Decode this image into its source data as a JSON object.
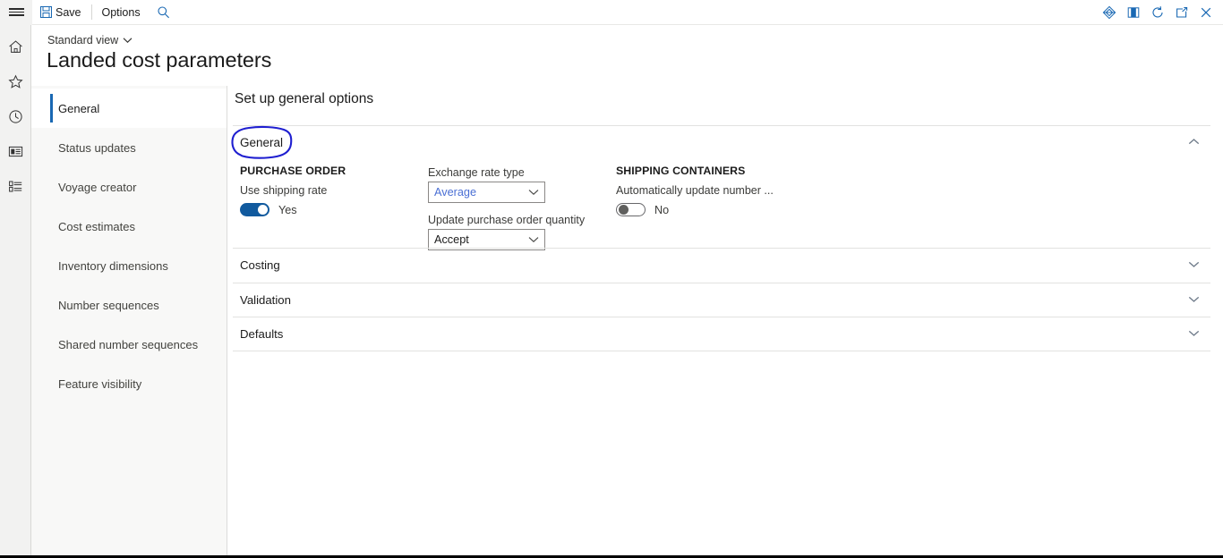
{
  "topbar": {
    "menu_icon": "hamburger-icon",
    "save_label": "Save",
    "save_icon": "save-disk-icon",
    "options_label": "Options",
    "search_icon": "search-icon",
    "right_icons": [
      {
        "name": "company-diamond-icon",
        "glyph": "diamond"
      },
      {
        "name": "contrast-icon",
        "glyph": "contrast"
      },
      {
        "name": "refresh-icon",
        "glyph": "refresh"
      },
      {
        "name": "open-in-new-window-icon",
        "glyph": "popout"
      },
      {
        "name": "close-icon",
        "glyph": "close"
      }
    ]
  },
  "rail": {
    "items": [
      {
        "name": "home-icon",
        "glyph": "home"
      },
      {
        "name": "favorites-star-icon",
        "glyph": "star"
      },
      {
        "name": "recent-clock-icon",
        "glyph": "clock"
      },
      {
        "name": "workspaces-icon",
        "glyph": "workspace"
      },
      {
        "name": "modules-list-icon",
        "glyph": "list"
      }
    ]
  },
  "header": {
    "view_label": "Standard view",
    "view_chevron": "chevron-down-icon",
    "title": "Landed cost parameters"
  },
  "nav": {
    "items": [
      {
        "label": "General",
        "selected": true
      },
      {
        "label": "Status updates",
        "selected": false
      },
      {
        "label": "Voyage creator",
        "selected": false
      },
      {
        "label": "Cost estimates",
        "selected": false
      },
      {
        "label": "Inventory dimensions",
        "selected": false
      },
      {
        "label": "Number sequences",
        "selected": false
      },
      {
        "label": "Shared number sequences",
        "selected": false
      },
      {
        "label": "Feature visibility",
        "selected": false
      }
    ]
  },
  "content": {
    "title": "Set up general options",
    "sections": [
      {
        "title": "General",
        "expanded": true,
        "chevron": "chevron-up-icon"
      },
      {
        "title": "Costing",
        "expanded": false,
        "chevron": "chevron-down-icon"
      },
      {
        "title": "Validation",
        "expanded": false,
        "chevron": "chevron-down-icon"
      },
      {
        "title": "Defaults",
        "expanded": false,
        "chevron": "chevron-down-icon"
      }
    ],
    "general": {
      "col1": {
        "group_label": "PURCHASE ORDER",
        "use_shipping_rate_label": "Use shipping rate",
        "use_shipping_rate_value": "Yes",
        "use_shipping_rate_on": true
      },
      "col2": {
        "exchange_rate_type_label": "Exchange rate type",
        "exchange_rate_type_value": "Average",
        "update_po_qty_label": "Update purchase order quantity",
        "update_po_qty_value": "Accept"
      },
      "col3": {
        "group_label": "SHIPPING CONTAINERS",
        "auto_update_label": "Automatically update number ...",
        "auto_update_value": "No",
        "auto_update_on": false
      }
    }
  },
  "colors": {
    "accent_blue": "#1968b3",
    "toggle_on": "#115a9e",
    "combo_accent_text": "#4a6fd4",
    "annotation_blue": "#1f1fd0"
  },
  "annotation": {
    "name": "highlight-ellipse-general",
    "shape": "hand-drawn-ellipse",
    "target": "General"
  }
}
